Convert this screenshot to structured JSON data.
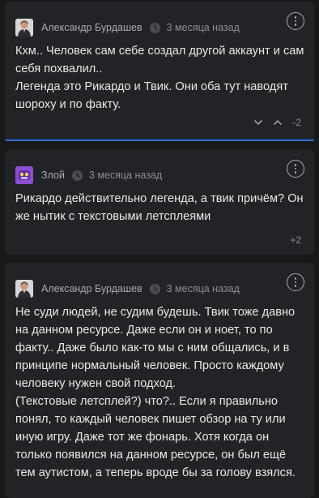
{
  "comments": [
    {
      "author": "Александр Бурдашев",
      "time": "3 месяца назад",
      "text": "Кхм.. Человек сам себе создал другой аккаунт и сам себя похвалил..\nЛегенда это Рикардо и Твик. Они оба тут наводят шороху и по факту.",
      "score": "-2"
    },
    {
      "author": "Злой",
      "time": "3 месяца назад",
      "text": "Рикардо действительно легенда, а твик причём? Он же нытик с текстовыми летсплеями",
      "score": "+2"
    },
    {
      "author": "Александр Бурдашев",
      "time": "3 месяца назад",
      "text": "Не суди людей, не судим будешь. Твик тоже давно на данном ресурсе. Даже если он и ноет, то по факту.. Даже было как-то мы с ним общались, и в принципе нормальный человек. Просто каждому человеку нужен свой подход.\n(Текстовые летсплей?) что?.. Если я правильно понял, то каждый человек пишет обзор на ту или иную игру. Даже тот же фонарь. Хотя когда он только появился на данном ресурсе, он был ещё тем аутистом, а теперь вроде бы за голову взялся."
    }
  ],
  "colors": {
    "page_bg": "#17181a",
    "card_bg": "#222326",
    "accent": "#2f6fd6"
  },
  "icons": {
    "clock": "clock-icon",
    "menu": "kebab-menu-icon",
    "down": "chevron-down-icon",
    "up": "chevron-up-icon"
  }
}
